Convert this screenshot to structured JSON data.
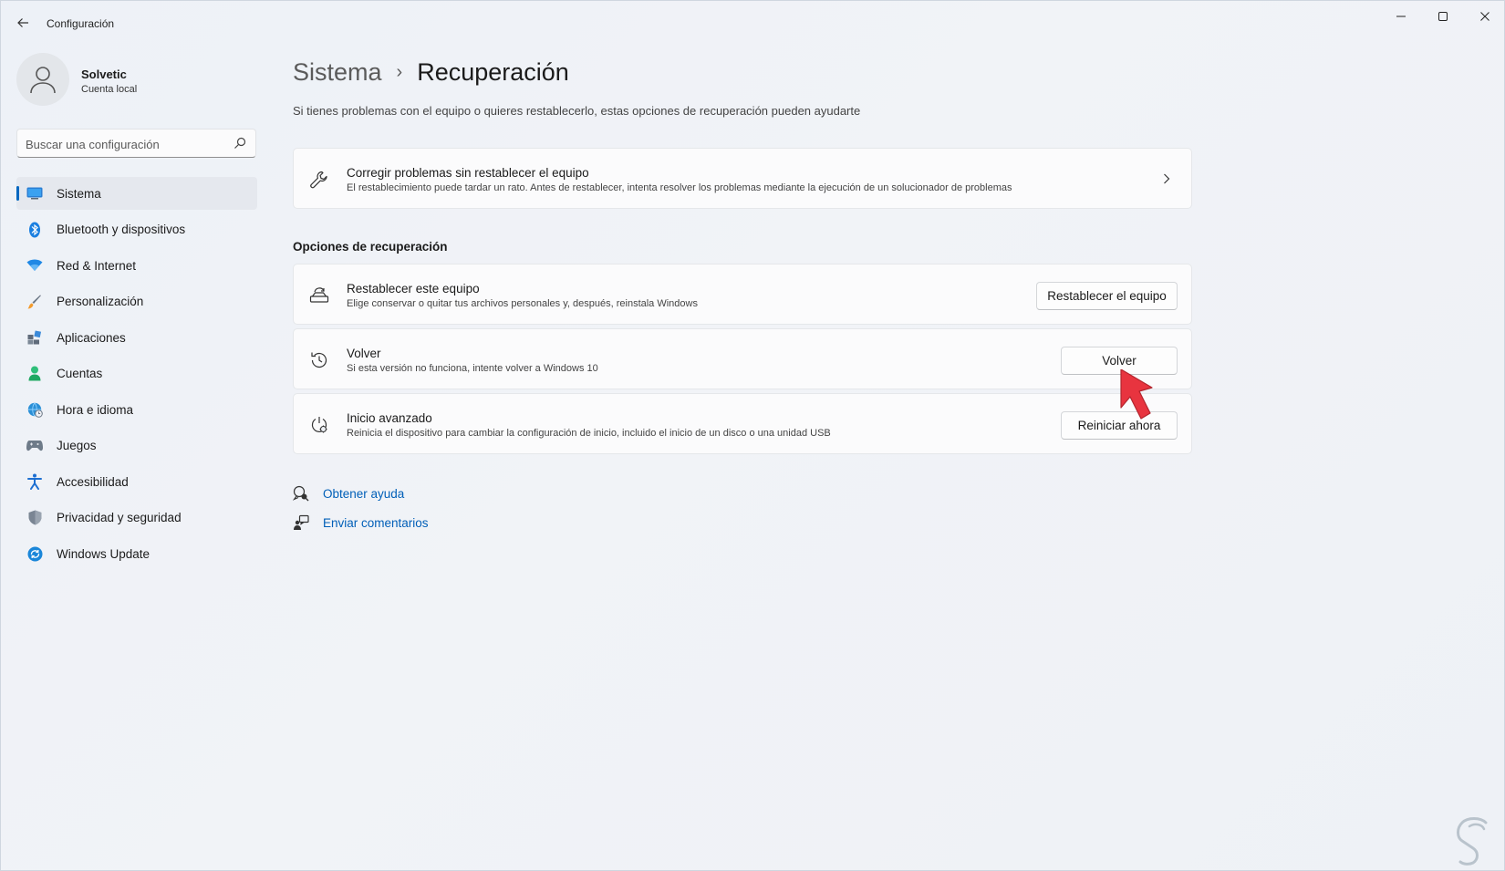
{
  "window": {
    "title": "Configuración"
  },
  "profile": {
    "name": "Solvetic",
    "account_type": "Cuenta local"
  },
  "search": {
    "placeholder": "Buscar una configuración"
  },
  "sidebar": {
    "items": [
      {
        "label": "Sistema",
        "icon": "monitor-icon",
        "active": true
      },
      {
        "label": "Bluetooth y dispositivos",
        "icon": "bluetooth-icon"
      },
      {
        "label": "Red & Internet",
        "icon": "wifi-icon"
      },
      {
        "label": "Personalización",
        "icon": "brush-icon"
      },
      {
        "label": "Aplicaciones",
        "icon": "apps-icon"
      },
      {
        "label": "Cuentas",
        "icon": "person-icon"
      },
      {
        "label": "Hora e idioma",
        "icon": "globe-clock-icon"
      },
      {
        "label": "Juegos",
        "icon": "gamepad-icon"
      },
      {
        "label": "Accesibilidad",
        "icon": "accessibility-icon"
      },
      {
        "label": "Privacidad y seguridad",
        "icon": "shield-icon"
      },
      {
        "label": "Windows Update",
        "icon": "update-icon"
      }
    ]
  },
  "breadcrumb": {
    "parent": "Sistema",
    "separator": "›",
    "current": "Recuperación"
  },
  "page": {
    "description": "Si tienes problemas con el equipo o quieres restablecerlo, estas opciones de recuperación pueden ayudarte"
  },
  "fix_card": {
    "title": "Corregir problemas sin restablecer el equipo",
    "subtitle": "El restablecimiento puede tardar un rato. Antes de restablecer, intenta resolver los problemas mediante la ejecución de un solucionador de problemas"
  },
  "recovery": {
    "section_title": "Opciones de recuperación",
    "options": [
      {
        "title": "Restablecer este equipo",
        "subtitle": "Elige conservar o quitar tus archivos personales y, después, reinstala Windows",
        "button": "Restablecer el equipo"
      },
      {
        "title": "Volver",
        "subtitle": "Si esta versión no funciona, intente volver a Windows 10",
        "button": "Volver"
      },
      {
        "title": "Inicio avanzado",
        "subtitle": "Reinicia el dispositivo para cambiar la configuración de inicio, incluido el inicio de un disco o una unidad USB",
        "button": "Reiniciar ahora"
      }
    ]
  },
  "links": {
    "help": "Obtener ayuda",
    "feedback": "Enviar comentarios"
  },
  "colors": {
    "accent": "#0067c0",
    "link": "#005fb8",
    "pointer": "#e8343f"
  }
}
